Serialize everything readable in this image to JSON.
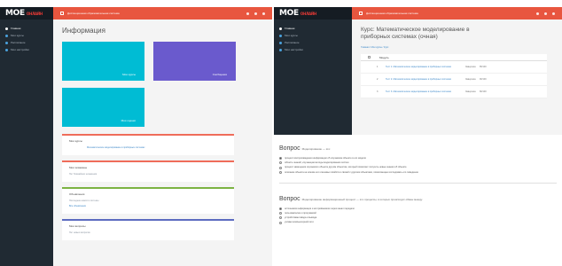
{
  "left": {
    "logo": {
      "part1": "MOE",
      "part2": "ОНЛАЙН"
    },
    "topbar": {
      "title": "Дистанционная образовательная система"
    },
    "sidebar": {
      "items": [
        {
          "label": "Главная",
          "active": true
        },
        {
          "label": "Мои курсы",
          "active": false
        },
        {
          "label": "Расписание",
          "active": false
        },
        {
          "label": "Мои настройки",
          "active": false
        }
      ]
    },
    "page_title": "Информация",
    "tiles": [
      {
        "label": "Мои курсы",
        "color": "#00bcd4"
      },
      {
        "label": "Сообщения",
        "color": "#6a5acd"
      },
      {
        "label": "Мои оценки",
        "color": "#00bcd4"
      }
    ],
    "cards": [
      {
        "title": "Мои курсы",
        "line": "Математическое моделирование в приборных системах",
        "accent": "#ef6c5a"
      },
      {
        "title": "Мои экзамены",
        "line": "Нет ближайших экзаменов",
        "accent": "#ef6c5a"
      },
      {
        "title": "Объявления",
        "line": "Последние новости системы",
        "line2": "Все объявления",
        "accent": "#7cb342"
      },
      {
        "title": "Мои вопросы",
        "line": "Нет новых вопросов",
        "accent": "#5c6bc0"
      }
    ]
  },
  "right": {
    "topbar": {
      "title": "Дистанционная образовательная система"
    },
    "sidebar": {
      "items": [
        {
          "label": "Главная",
          "active": true
        },
        {
          "label": "Мои курсы",
          "active": false
        },
        {
          "label": "Расписание",
          "active": false
        },
        {
          "label": "Мои настройки",
          "active": false
        }
      ]
    },
    "course_title": "Курс: Математическое моделирование в приборных системах (очная)",
    "breadcrumb": "Главная / Мои курсы / Курс",
    "table": {
      "header": "Модуль",
      "rows": [
        {
          "num": "1",
          "link": "Тест 1. Математическое моделирование в приборных системах",
          "status": "Завершён",
          "score": "85/100"
        },
        {
          "num": "2",
          "link": "Тест 2. Математическое моделирование в приборных системах",
          "status": "Завершён",
          "score": "90/100"
        },
        {
          "num": "3",
          "link": "Тест 3. Математическое моделирование в приборных системах",
          "status": "Завершён",
          "score": "80/100"
        }
      ]
    },
    "questions": [
      {
        "title": "Вопрос",
        "subtitle": "Моделирование — это:",
        "options": [
          {
            "text": "процесс воспроизведения информации об изучаемом объекте в его модели",
            "selected": true
          },
          {
            "text": "область знаний, изучающая методы моделирования систем",
            "selected": false
          },
          {
            "text": "процесс замещения изучаемого объекта другим объектом, который позволяет получить новые знания об объекте",
            "selected": false
          },
          {
            "text": "описание объекта на основе его ключевых свойств и связей с другими объектами, позволяющее исследовать его поведение",
            "selected": false
          }
        ]
      },
      {
        "title": "Вопрос",
        "subtitle": "Моделирование информационный процесс — это процессы, в которых происходит обмен между:",
        "options": [
          {
            "text": "источником информации и её приёмником через канал передачи",
            "selected": true
          },
          {
            "text": "пользователем и программой",
            "selected": false
          },
          {
            "text": "устройствами ввода и вывода",
            "selected": false
          },
          {
            "text": "узлами компьютерной сети",
            "selected": false
          }
        ]
      }
    ]
  }
}
